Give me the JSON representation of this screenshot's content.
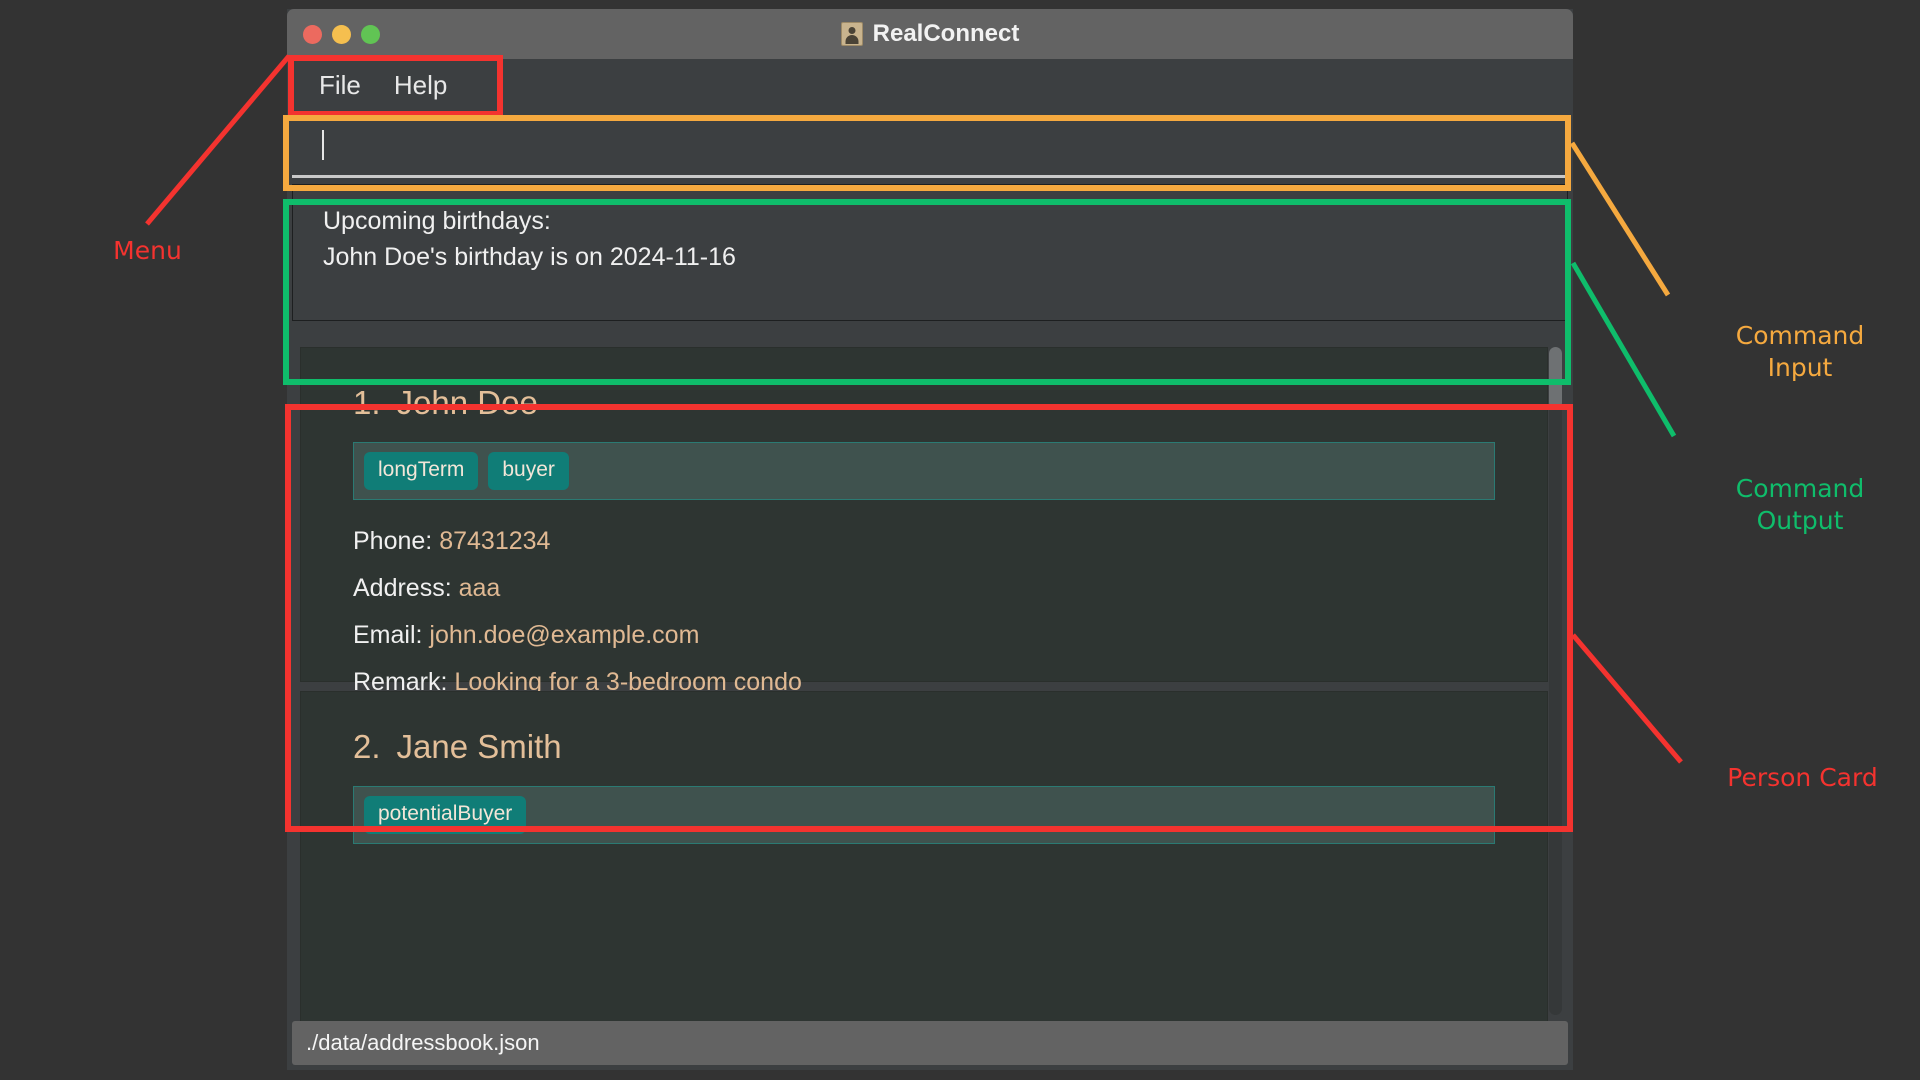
{
  "window": {
    "title": "RealConnect",
    "title_icon": "contact-person-icon",
    "traffic_lights": [
      "close-red",
      "minimize-yellow",
      "maximize-green"
    ]
  },
  "menu": {
    "items": [
      {
        "label": "File"
      },
      {
        "label": "Help"
      }
    ]
  },
  "command_input": {
    "value": "",
    "placeholder": ""
  },
  "command_output": {
    "lines": [
      "Upcoming birthdays:",
      "John Doe's birthday is on 2024-11-16"
    ]
  },
  "person_list": {
    "cards": [
      {
        "index": "1.",
        "name": "John Doe",
        "tags": [
          "longTerm",
          "buyer"
        ],
        "fields": [
          {
            "label": "Phone:",
            "value": "87431234"
          },
          {
            "label": "Address:",
            "value": "aaa"
          },
          {
            "label": "Email:",
            "value": "john.doe@example.com"
          },
          {
            "label": "Remark:",
            "value": "Looking for a 3-bedroom condo"
          }
        ]
      },
      {
        "index": "2.",
        "name": "Jane Smith",
        "tags": [
          "potentialBuyer"
        ],
        "fields": []
      }
    ]
  },
  "status_bar": {
    "path": "./data/addressbook.json"
  },
  "annotations": [
    {
      "label": "Menu",
      "color": "#f4332f"
    },
    {
      "label": "Command\nInput",
      "color": "#f5a93f"
    },
    {
      "label": "Command\nOutput",
      "color": "#0fbd6b"
    },
    {
      "label": "Person Card",
      "color": "#f4332f"
    }
  ],
  "colors": {
    "background": "#333333",
    "window_chrome": "#636363",
    "panel": "#3c3f41",
    "card": "#2e3532",
    "tag": "#107d77",
    "tag_strip": "#3f524e",
    "accent_text": "#e0b993",
    "annotation_red": "#f4332f",
    "annotation_orange": "#f5a93f",
    "annotation_green": "#0fbd6b"
  }
}
